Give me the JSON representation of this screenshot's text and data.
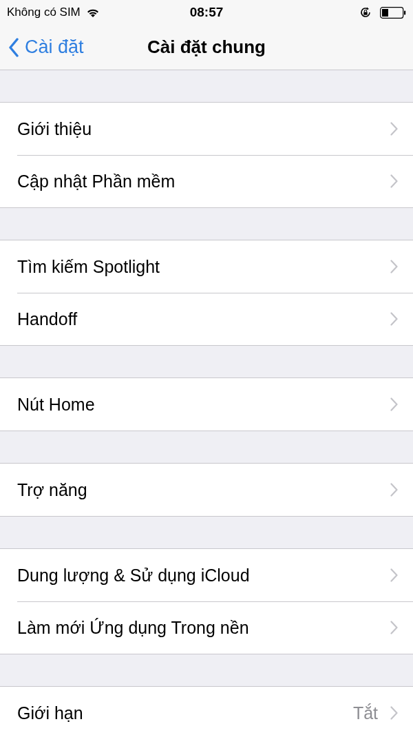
{
  "status_bar": {
    "carrier": "Không có SIM",
    "time": "08:57"
  },
  "nav": {
    "back": "Cài đặt",
    "title": "Cài đặt chung"
  },
  "groups": [
    {
      "items": [
        {
          "label": "Giới thiệu"
        },
        {
          "label": "Cập nhật Phần mềm"
        }
      ]
    },
    {
      "items": [
        {
          "label": "Tìm kiếm Spotlight"
        },
        {
          "label": "Handoff"
        }
      ]
    },
    {
      "items": [
        {
          "label": "Nút Home"
        }
      ]
    },
    {
      "items": [
        {
          "label": "Trợ năng"
        }
      ]
    },
    {
      "items": [
        {
          "label": "Dung lượng & Sử dụng iCloud"
        },
        {
          "label": "Làm mới Ứng dụng Trong nền"
        }
      ]
    },
    {
      "items": [
        {
          "label": "Giới hạn",
          "value": "Tắt"
        }
      ]
    }
  ]
}
